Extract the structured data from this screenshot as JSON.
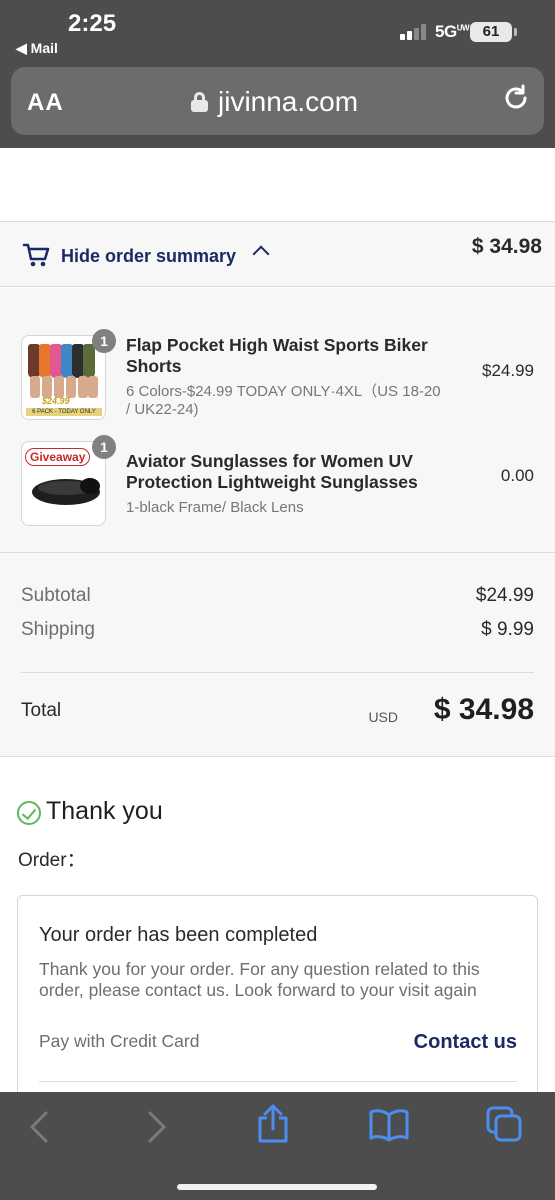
{
  "status_bar": {
    "time": "2:25",
    "back_app": "◀ Mail",
    "network": "5G",
    "network_sup": "UW",
    "battery": "61"
  },
  "browser": {
    "text_size_label": "AA",
    "domain": "jivinna.com"
  },
  "summary_toggle": {
    "label": "Hide order summary",
    "total": "$ 34.98"
  },
  "items": [
    {
      "qty": "1",
      "name": "Flap Pocket High Waist Sports Biker Shorts",
      "variant": "6 Colors-$24.99 TODAY ONLY·4XL（US 18-20 / UK22-24)",
      "price": "$24.99",
      "thumb_price": "$24.99",
      "thumb_tagline": "6 PACK - TODAY ONLY"
    },
    {
      "qty": "1",
      "name": "Aviator Sunglasses for Women UV Protection Lightweight Sunglasses",
      "variant": "1-black Frame/ Black Lens",
      "price": "0.00",
      "thumb_badge": "Giveaway"
    }
  ],
  "totals": {
    "subtotal_label": "Subtotal",
    "subtotal": "$24.99",
    "shipping_label": "Shipping",
    "shipping": "$ 9.99",
    "total_label": "Total",
    "currency": "USD",
    "total": "$ 34.98"
  },
  "confirmation": {
    "title": "Thank you",
    "order_label": "Order：",
    "card_heading": "Your order has been completed",
    "card_text": "Thank you for your order. For any question related to this order, please contact us. Look forward to your visit again",
    "payment": "Pay with Credit Card",
    "contact_label": "Contact us"
  },
  "colors": {
    "accent": "#1b2a63",
    "success": "#5cb85c",
    "toolbar_icon": "#4a8ff0"
  },
  "icons": [
    "cart-icon",
    "chevron-up-icon",
    "lock-icon",
    "reload-icon",
    "check-circle-icon",
    "back-icon",
    "forward-icon",
    "share-icon",
    "bookmarks-icon",
    "tabs-icon"
  ]
}
